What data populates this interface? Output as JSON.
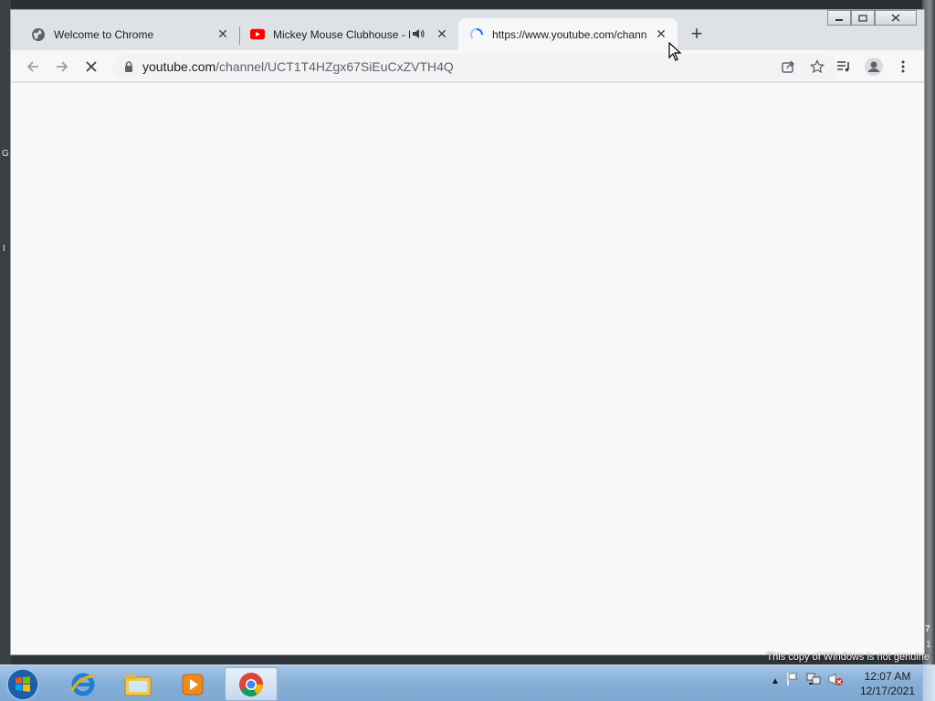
{
  "browser": {
    "tabs": [
      {
        "title": "Welcome to Chrome",
        "icon": "chrome-globe-icon",
        "active": false
      },
      {
        "title": "Mickey Mouse Clubhouse - Mick",
        "icon": "youtube-icon",
        "audio": true,
        "active": false
      },
      {
        "title": "https://www.youtube.com/channel/",
        "icon": "loading-spinner-icon",
        "active": true
      }
    ],
    "new_tab_label": "+",
    "address": {
      "host": "youtube.com",
      "path": "/channel/UCT1T4HZgx67SiEuCxZVTH4Q"
    }
  },
  "desktop": {
    "watermark": "This copy of Windows is not genuine",
    "edge_glyphs": [
      "G",
      "I",
      "7",
      "1"
    ]
  },
  "taskbar": {
    "apps": [
      "start-orb",
      "internet-explorer",
      "windows-explorer",
      "media-player",
      "chrome"
    ],
    "clock": {
      "time": "12:07 AM",
      "date": "12/17/2021"
    }
  },
  "colors": {
    "chrome_frame": "#dee1e6",
    "toolbar": "#f7f7f8",
    "youtube_red": "#ff0000",
    "taskbar": "#88b0d8"
  }
}
